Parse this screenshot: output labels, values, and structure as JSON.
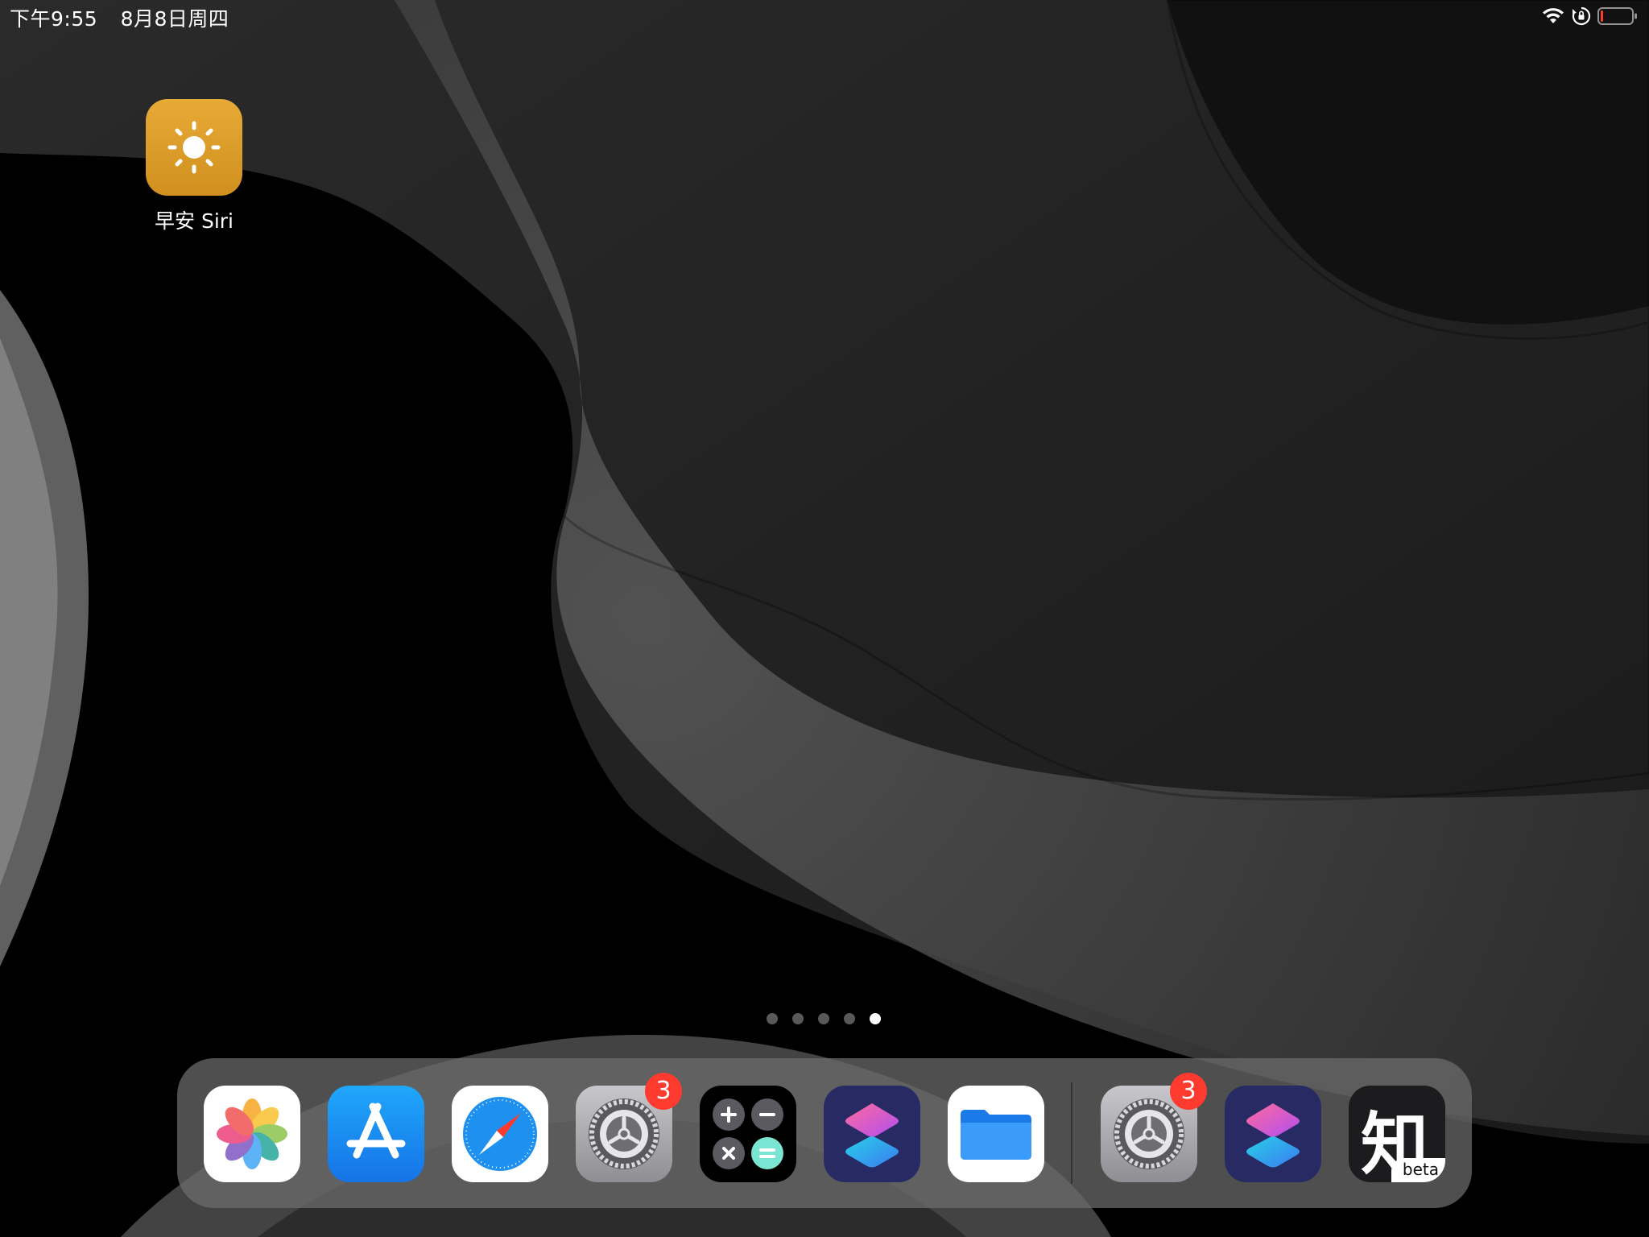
{
  "status_bar": {
    "time": "下午9:55",
    "date": "8月8日周四"
  },
  "home": {
    "apps": [
      {
        "label": "早安 Siri",
        "icon": "sun-icon",
        "color": "#e0a02e"
      }
    ]
  },
  "page_indicator": {
    "total": 5,
    "current": 5
  },
  "dock": {
    "apps": [
      {
        "name": "photos",
        "icon": "photos-icon"
      },
      {
        "name": "app-store",
        "icon": "app-store-icon"
      },
      {
        "name": "safari",
        "icon": "compass-icon"
      },
      {
        "name": "settings",
        "icon": "gear-icon",
        "badge": "3"
      },
      {
        "name": "calculator",
        "icon": "calculator-icon"
      },
      {
        "name": "shortcuts",
        "icon": "shortcuts-icon"
      },
      {
        "name": "files",
        "icon": "folder-icon"
      }
    ],
    "recent": [
      {
        "name": "settings",
        "icon": "gear-icon",
        "badge": "3"
      },
      {
        "name": "shortcuts",
        "icon": "shortcuts-icon"
      },
      {
        "name": "zhihu",
        "icon": "zhihu-icon",
        "glyph": "知",
        "tag": "beta"
      }
    ]
  },
  "colors": {
    "badge": "#ff3b30",
    "app_store": "#1a8cf2",
    "files": "#2a8ff5",
    "shortcuts_bg": "#2b2f6e"
  }
}
